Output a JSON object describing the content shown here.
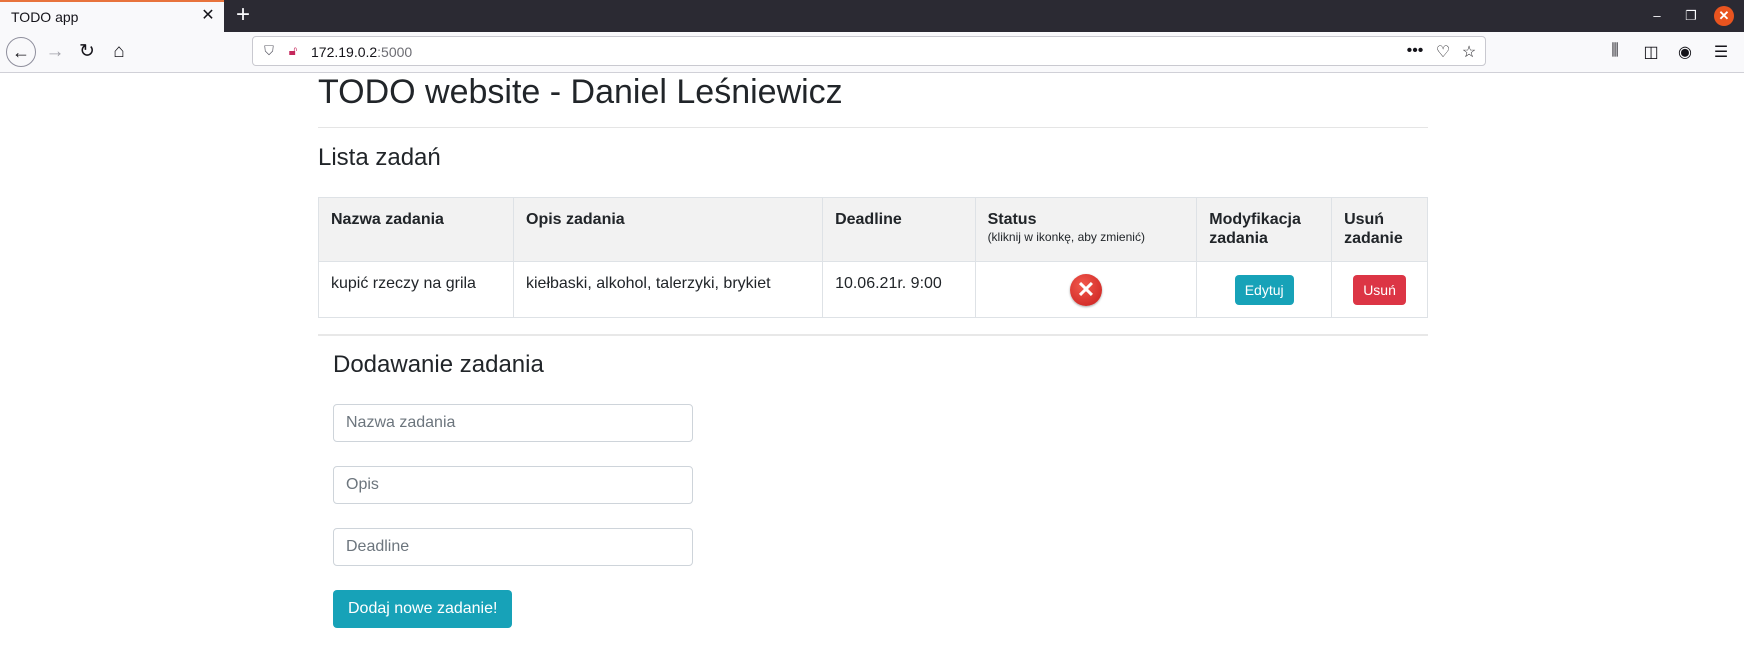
{
  "browser": {
    "tab_title": "TODO app",
    "url_host": "172.19.0.2",
    "url_port": ":5000"
  },
  "page": {
    "title": "TODO website - Daniel Leśniewicz",
    "list_heading": "Lista zadań",
    "table": {
      "headers": {
        "name": "Nazwa zadania",
        "description": "Opis zadania",
        "deadline": "Deadline",
        "status": "Status",
        "status_hint": "(kliknij w ikonkę, aby zmienić)",
        "modify": "Modyfikacja zadania",
        "delete": "Usuń zadanie"
      },
      "rows": [
        {
          "name": "kupić rzeczy na grila",
          "description": "kiełbaski, alkohol, talerzyki, brykiet",
          "deadline": "10.06.21r. 9:00",
          "status_icon": "x-circle-icon",
          "edit_label": "Edytuj",
          "delete_label": "Usuń"
        }
      ]
    },
    "add_heading": "Dodawanie zadania",
    "form": {
      "name_placeholder": "Nazwa zadania",
      "description_placeholder": "Opis",
      "deadline_placeholder": "Deadline",
      "submit_label": "Dodaj nowe zadanie!"
    }
  },
  "colors": {
    "info": "#17a2b8",
    "danger": "#dc3545",
    "status_not_done": "#d32f2f"
  }
}
